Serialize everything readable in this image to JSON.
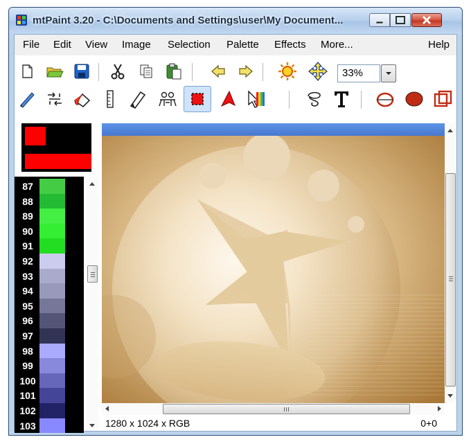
{
  "window": {
    "title": "mtPaint 3.20 - C:\\Documents and Settings\\user\\My Document..."
  },
  "menu": {
    "file": "File",
    "edit": "Edit",
    "view": "View",
    "image": "Image",
    "selection": "Selection",
    "palette": "Palette",
    "effects": "Effects",
    "more": "More...",
    "help": "Help"
  },
  "toolbar": {
    "zoom_value": "33%",
    "icons": [
      "new-icon",
      "open-icon",
      "save-icon",
      "cut-icon",
      "copy-icon",
      "paste-icon",
      "undo-icon",
      "redo-icon",
      "brightness-icon",
      "pan-icon",
      "zoom-dropdown-icon"
    ]
  },
  "tools": {
    "icons": [
      "paint-icon",
      "shuffle-icon",
      "flood-fill-icon",
      "line-icon",
      "smudge-icon",
      "clone-icon",
      "select-rectangle-icon",
      "select-polygon-icon",
      "gradient-icon",
      "lasso-icon",
      "text-icon",
      "ellipse-outline-icon",
      "ellipse-filled-icon",
      "rectangle-icon"
    ]
  },
  "colors": {
    "swatch_a": "#ff0000",
    "swatch_b": "#ff0000",
    "title_gradient": "#b9d1ec",
    "close_button": "#c43620"
  },
  "palette": [
    {
      "index": "87",
      "color": "#44cc44"
    },
    {
      "index": "88",
      "color": "#22bb33"
    },
    {
      "index": "89",
      "color": "#44ee44"
    },
    {
      "index": "90",
      "color": "#33ee33"
    },
    {
      "index": "91",
      "color": "#22dd22"
    },
    {
      "index": "92",
      "color": "#ccccee"
    },
    {
      "index": "93",
      "color": "#aaaacc"
    },
    {
      "index": "94",
      "color": "#9999bb"
    },
    {
      "index": "95",
      "color": "#777799"
    },
    {
      "index": "96",
      "color": "#555577"
    },
    {
      "index": "97",
      "color": "#333355"
    },
    {
      "index": "98",
      "color": "#aaaaff"
    },
    {
      "index": "99",
      "color": "#8888dd"
    },
    {
      "index": "100",
      "color": "#6666bb"
    },
    {
      "index": "101",
      "color": "#444499"
    },
    {
      "index": "102",
      "color": "#222266"
    },
    {
      "index": "103",
      "color": "#8888ff"
    }
  ],
  "status": {
    "image_size": "1280 x 1024 x RGB",
    "cursor_position": "0+0"
  }
}
